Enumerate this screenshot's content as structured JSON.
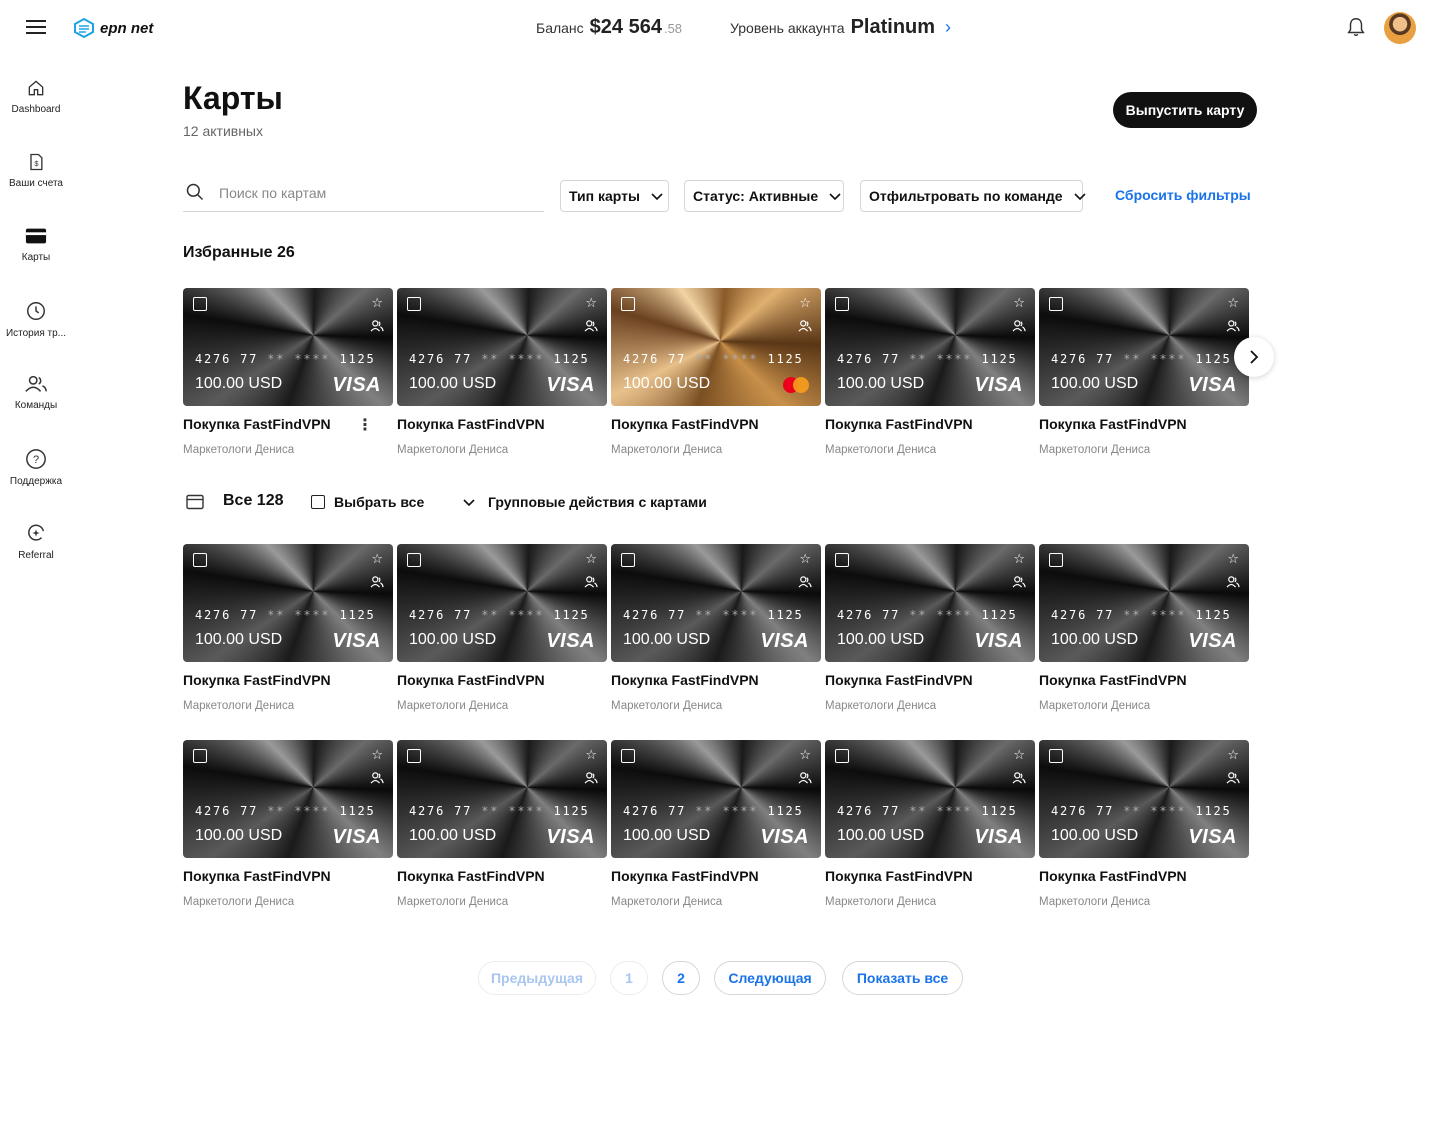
{
  "header": {
    "logo_text": "epn net",
    "balance_label": "Баланс",
    "balance_amount": "$24 564",
    "balance_cents": ".58",
    "level_label": "Уровень аккаунта",
    "level_value": "Platinum",
    "level_chevron": "›"
  },
  "sidebar": {
    "items": [
      {
        "label": "Dashboard",
        "icon": "home-icon"
      },
      {
        "label": "Ваши счета",
        "icon": "invoice-icon"
      },
      {
        "label": "Карты",
        "icon": "card-icon"
      },
      {
        "label": "История тр...",
        "icon": "history-icon"
      },
      {
        "label": "Команды",
        "icon": "team-icon"
      },
      {
        "label": "Поддержка",
        "icon": "help-icon"
      },
      {
        "label": "Referral",
        "icon": "referral-icon"
      }
    ]
  },
  "main": {
    "title": "Карты",
    "subtitle": "12 активных",
    "issue_button": "Выпустить карту",
    "search_placeholder": "Поиск по картам",
    "filters": {
      "card_type": "Тип карты",
      "status": "Статус: Активные",
      "team": "Отфильтровать по команде",
      "reset": "Сбросить фильтры"
    },
    "favorites_title": "Избранные 26",
    "all_title": "Все 128",
    "select_all": "Выбрать все",
    "group_actions": "Групповые действия с картами",
    "kebab": "⋮",
    "next_arrow": "chevron-right-icon"
  },
  "card": {
    "number_main": "4276 77",
    "number_mask1": "**",
    "number_mask2": "****",
    "number_last": "1125",
    "amount": "100.00 USD",
    "brand_visa": "VISA",
    "title": "Покупка FastFindVPN",
    "team": "Маркетологи Дениса",
    "star": "☆"
  },
  "favorites": [
    {
      "brand": "visa",
      "style": "dark"
    },
    {
      "brand": "visa",
      "style": "dark"
    },
    {
      "brand": "mastercard",
      "style": "gold"
    },
    {
      "brand": "visa",
      "style": "dark"
    },
    {
      "brand": "visa",
      "style": "dark"
    }
  ],
  "all_cards_count_rows": 2,
  "all_cards_per_row": 5,
  "pagination": {
    "prev": "Предыдущая",
    "pages": [
      "1",
      "2"
    ],
    "current": "2",
    "next": "Следующая",
    "show_all": "Показать все"
  },
  "colors": {
    "accent": "#1a73e8",
    "primary_button": "#111111"
  }
}
